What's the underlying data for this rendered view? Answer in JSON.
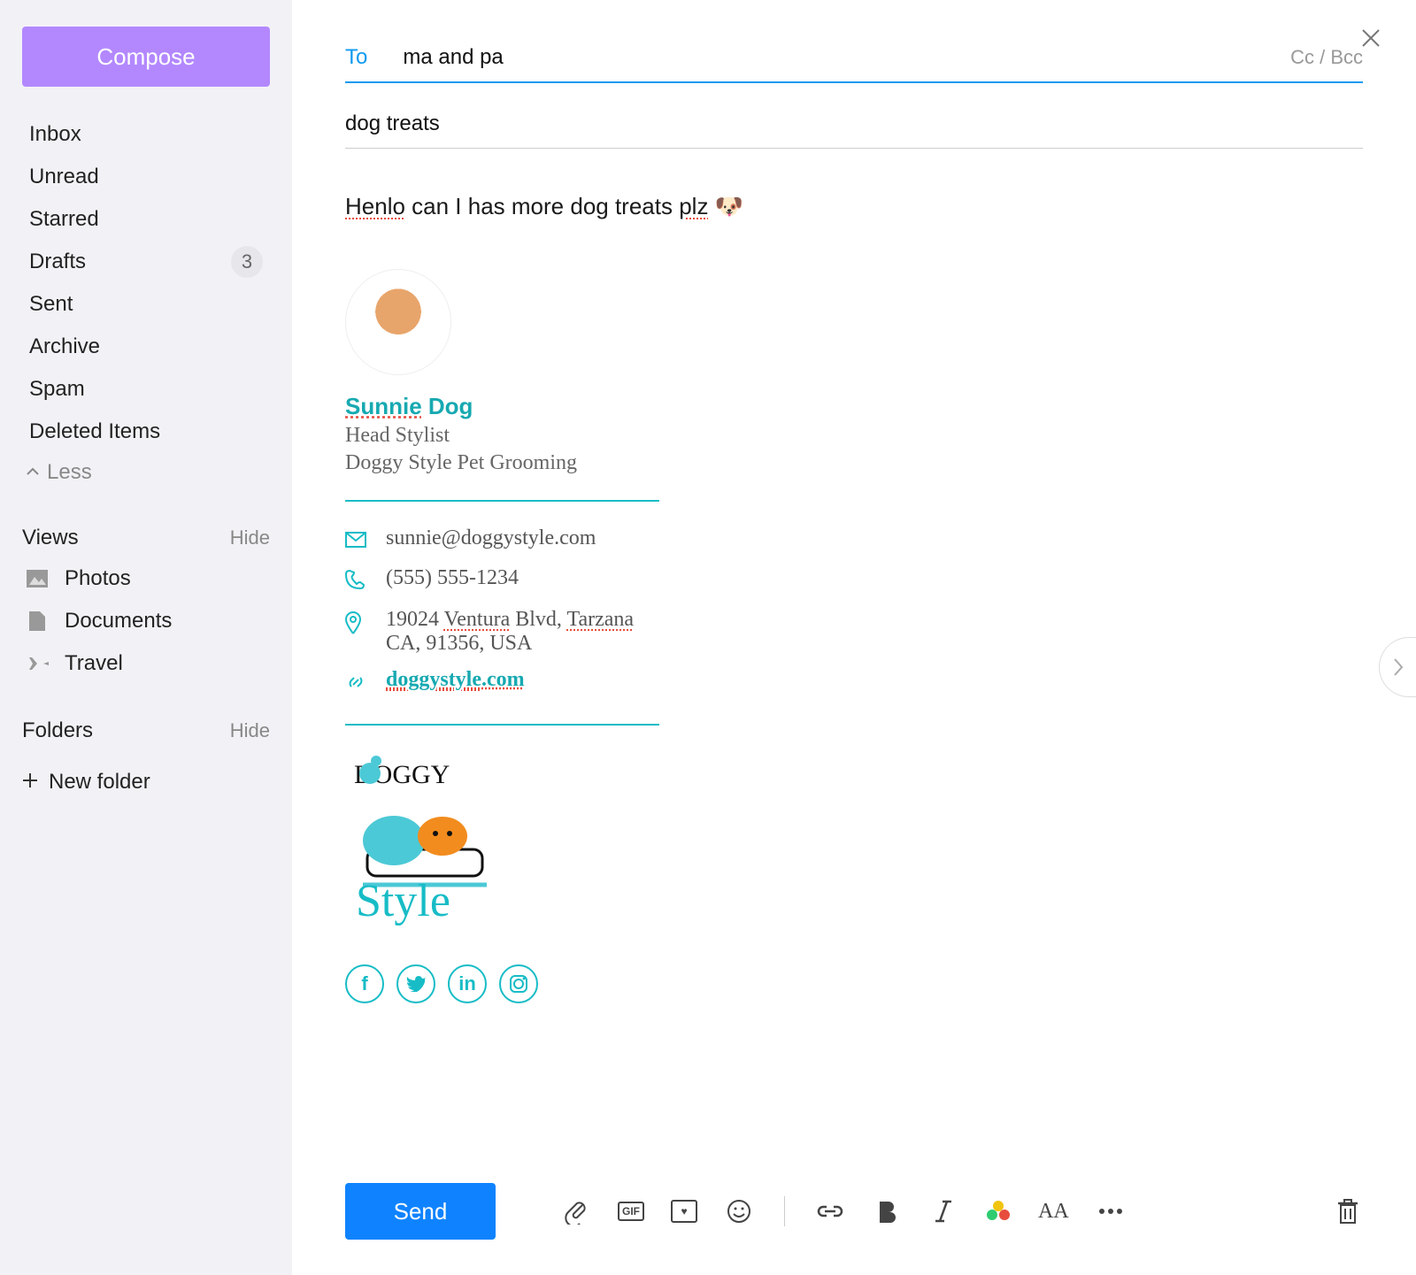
{
  "sidebar": {
    "compose_label": "Compose",
    "items": [
      {
        "label": "Inbox"
      },
      {
        "label": "Unread"
      },
      {
        "label": "Starred"
      },
      {
        "label": "Drafts",
        "count": "3"
      },
      {
        "label": "Sent"
      },
      {
        "label": "Archive"
      },
      {
        "label": "Spam"
      },
      {
        "label": "Deleted Items"
      }
    ],
    "less_label": "Less",
    "views_header": "Views",
    "hide_label": "Hide",
    "views": [
      {
        "label": "Photos"
      },
      {
        "label": "Documents"
      },
      {
        "label": "Travel"
      }
    ],
    "folders_header": "Folders",
    "new_folder_label": "New folder"
  },
  "compose": {
    "to_label": "To",
    "to_value": "ma and pa",
    "cc_bcc_label": "Cc / Bcc",
    "subject_value": "dog treats",
    "body_parts": {
      "w1": "Henlo",
      "w2": " can I has more dog treats ",
      "w3": "plz",
      "emoji": "🐶"
    }
  },
  "signature": {
    "name_first": "Sunnie",
    "name_last": " Dog",
    "title": "Head Stylist",
    "company": "Doggy Style Pet Grooming",
    "email": "sunnie@doggystyle.com",
    "phone": "(555) 555-1234",
    "address_line1_a": "19024 ",
    "address_line1_b": "Ventura",
    "address_line1_c": " Blvd, ",
    "address_line1_d": "Tarzana",
    "address_line2": "CA, 91356, USA",
    "website_a": "doggystyle",
    "website_b": ".com",
    "logo_top": "DOGGY",
    "logo_bottom": "Style",
    "social": {
      "fb": "f",
      "tw": "t",
      "in": "in",
      "ig": "ig"
    }
  },
  "toolbar": {
    "send_label": "Send",
    "gif_label": "GIF",
    "aa_label": "AA"
  }
}
